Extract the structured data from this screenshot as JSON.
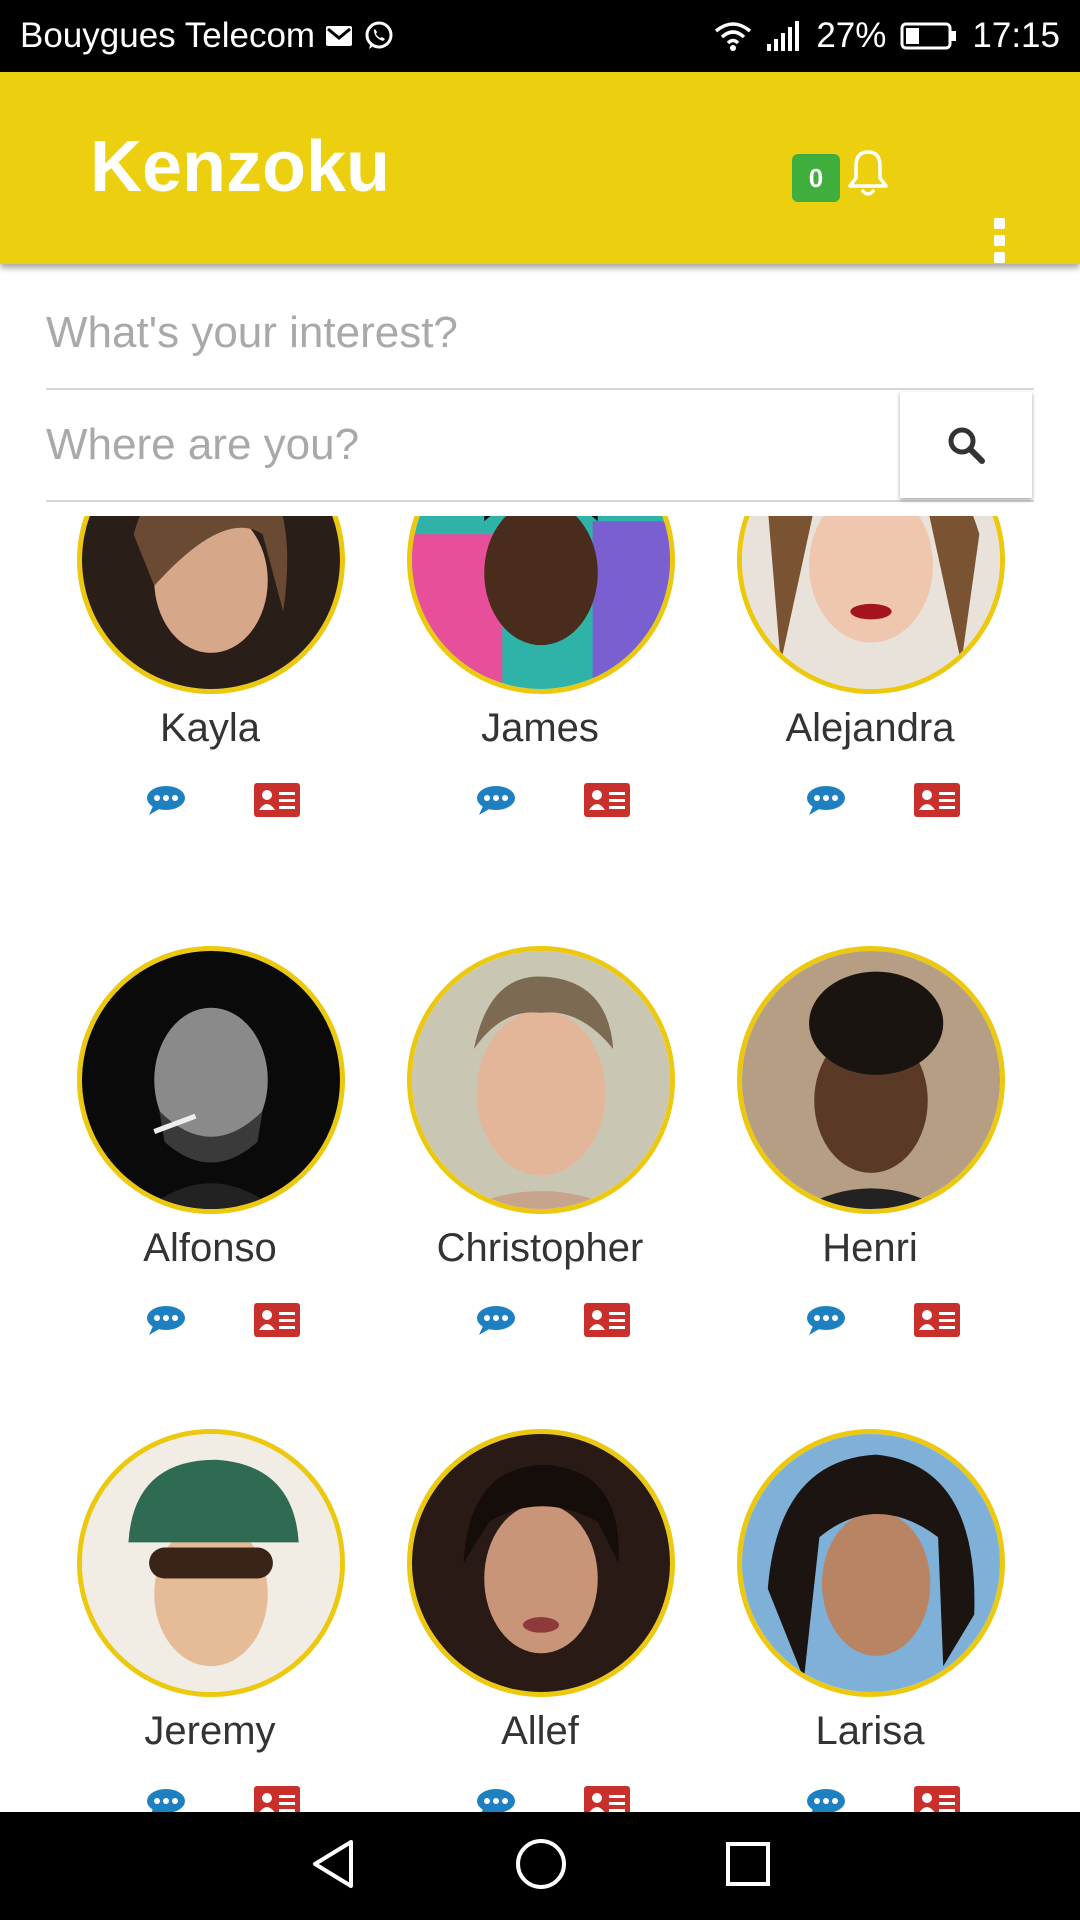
{
  "status_bar": {
    "carrier": "Bouygues Telecom",
    "battery": "27%",
    "time": "17:15",
    "icons": [
      "gmail-icon",
      "whatsapp-icon",
      "wifi-icon",
      "signal-icon",
      "battery-icon"
    ]
  },
  "app_bar": {
    "title": "Kenzoku",
    "notification_count": "0",
    "bell_icon": "bell-icon",
    "menu_icon": "more-vertical-icon",
    "color": "#ecd00f",
    "badge_color": "#3fae3d"
  },
  "search": {
    "interest_placeholder": "What's your interest?",
    "location_placeholder": "Where are you?",
    "button_icon": "search-icon"
  },
  "people": [
    {
      "name": "Kayla"
    },
    {
      "name": "James"
    },
    {
      "name": "Alejandra"
    },
    {
      "name": "Alfonso"
    },
    {
      "name": "Christopher"
    },
    {
      "name": "Henri"
    },
    {
      "name": "Jeremy"
    },
    {
      "name": "Allef"
    },
    {
      "name": "Larisa"
    }
  ],
  "card_actions": {
    "chat_icon": "chat-bubble-icon",
    "profile_icon": "id-card-icon",
    "chat_color": "#1e7fc1",
    "profile_color": "#c9302c"
  },
  "nav_bar": {
    "icons": [
      "back-icon",
      "home-icon",
      "recents-icon"
    ]
  }
}
